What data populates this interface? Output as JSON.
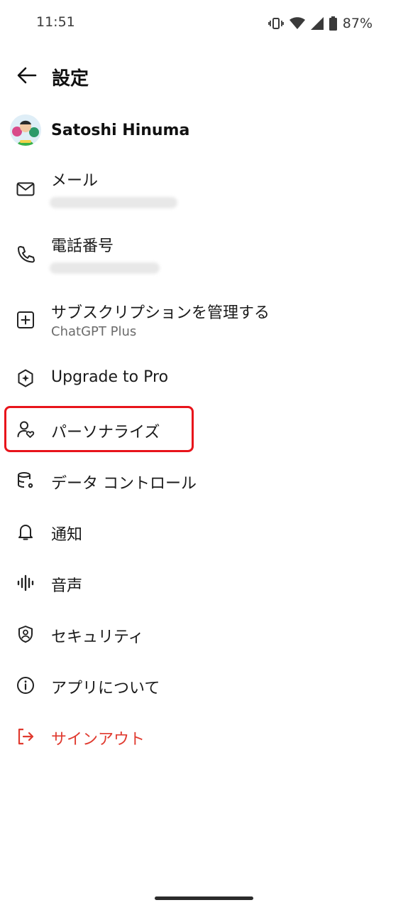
{
  "status_bar": {
    "time": "11:51",
    "battery": "87%"
  },
  "header": {
    "title": "設定"
  },
  "profile": {
    "name": "Satoshi Hinuma"
  },
  "items": [
    {
      "label": "メール",
      "sub": "",
      "icon": "mail-icon"
    },
    {
      "label": "電話番号",
      "sub": "",
      "icon": "phone-icon"
    },
    {
      "label": "サブスクリプションを管理する",
      "sub": "ChatGPT Plus",
      "icon": "plus-square-icon"
    },
    {
      "label": "Upgrade to Pro",
      "icon": "sparkle-badge-icon"
    },
    {
      "label": "パーソナライズ",
      "icon": "person-heart-icon"
    },
    {
      "label": "データ コントロール",
      "icon": "database-gear-icon"
    },
    {
      "label": "通知",
      "icon": "bell-icon"
    },
    {
      "label": "音声",
      "icon": "waveform-icon"
    },
    {
      "label": "セキュリティ",
      "icon": "shield-user-icon"
    },
    {
      "label": "アプリについて",
      "icon": "info-icon"
    },
    {
      "label": "サインアウト",
      "icon": "sign-out-icon"
    }
  ],
  "colors": {
    "danger": "#e03a2f",
    "highlight": "#e8141b"
  }
}
